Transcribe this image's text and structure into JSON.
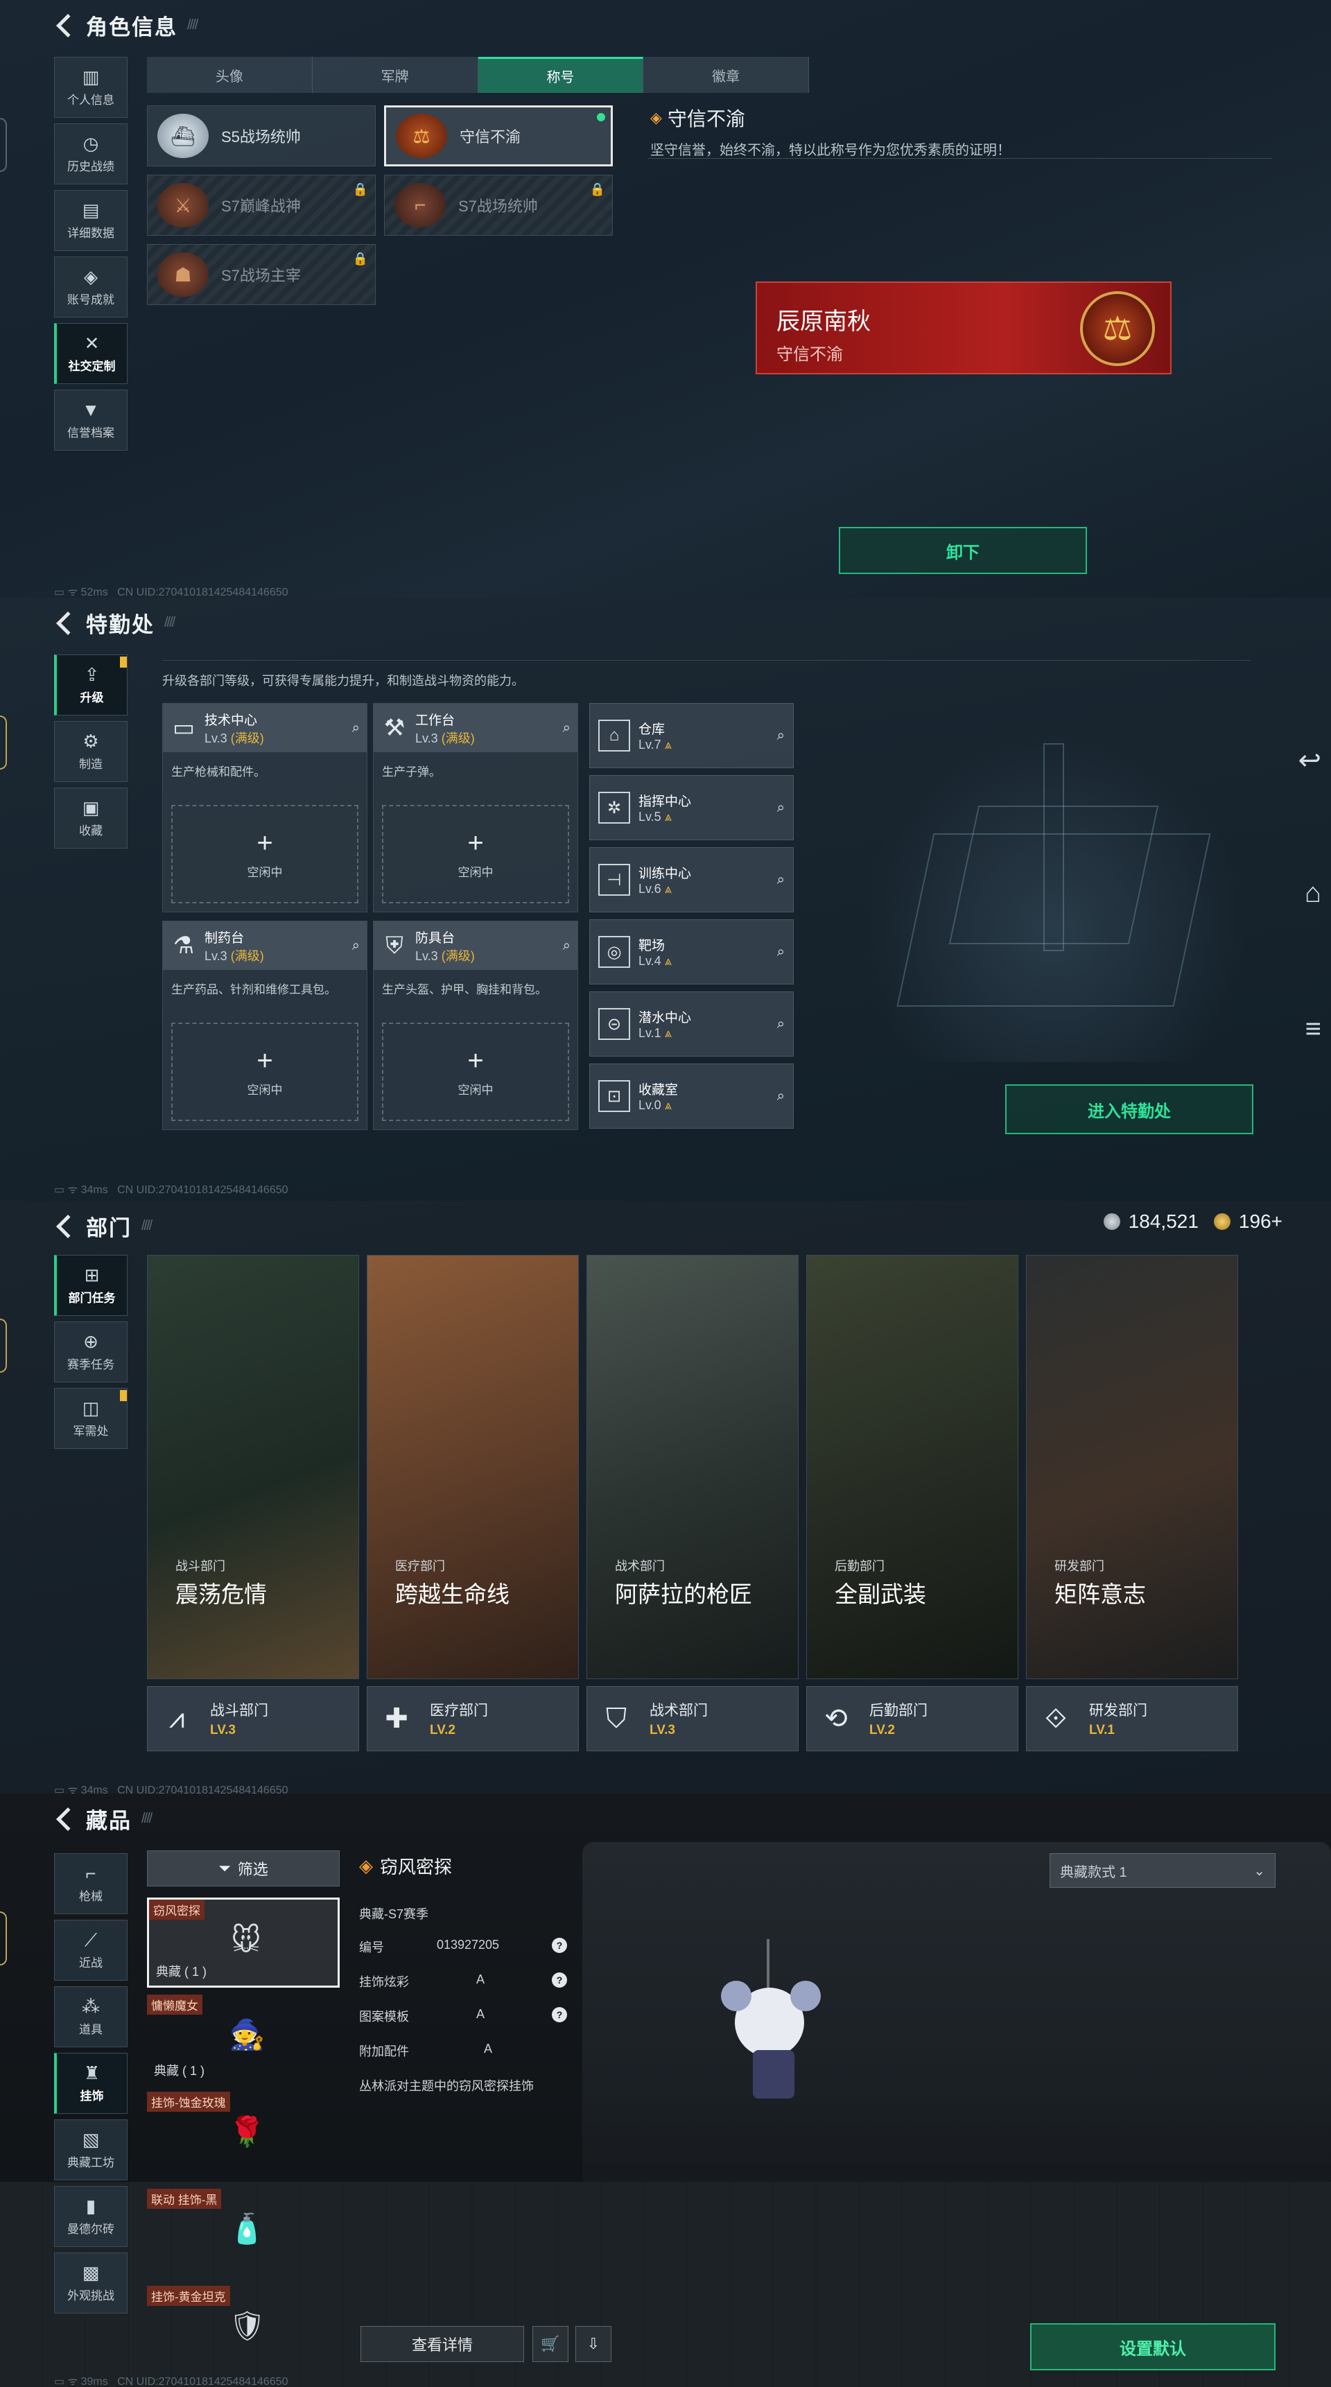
{
  "p1": {
    "title": "角色信息",
    "sidebar": [
      {
        "icon": "▥",
        "label": "个人信息"
      },
      {
        "icon": "◷",
        "label": "历史战绩"
      },
      {
        "icon": "▤",
        "label": "详细数据"
      },
      {
        "icon": "◈",
        "label": "账号成就"
      },
      {
        "icon": "✕",
        "label": "社交定制"
      },
      {
        "icon": "▼",
        "label": "信誉档案"
      }
    ],
    "tabs": [
      "头像",
      "军牌",
      "称号",
      "徽章"
    ],
    "titles": [
      {
        "name": "S5战场统帅",
        "locked": false
      },
      {
        "name": "守信不渝",
        "locked": false
      },
      {
        "name": "S7巅峰战神",
        "locked": true
      },
      {
        "name": "S7战场统帅",
        "locked": true
      },
      {
        "name": "S7战场主宰",
        "locked": true
      }
    ],
    "selected": {
      "name": "守信不渝",
      "desc": "坚守信誉，始终不渝，特以此称号作为您优秀素质的证明！"
    },
    "banner": {
      "player": "辰原南秋",
      "title": "守信不渝"
    },
    "unequip": "卸下",
    "status": "52ms",
    "uid": "CN UID:270410181425484146650"
  },
  "p2": {
    "title": "特勤处",
    "sidebar": [
      {
        "icon": "⇪",
        "label": "升级"
      },
      {
        "icon": "⚙",
        "label": "制造"
      },
      {
        "icon": "▣",
        "label": "收藏"
      }
    ],
    "tip": "升级各部门等级，可获得专属能力提升，和制造战斗物资的能力。",
    "facilities": [
      {
        "icon": "▭",
        "name": "技术中心",
        "lv": "Lv.3",
        "max": "(满级)",
        "desc": "生产枪械和配件。",
        "idle": "空闲中"
      },
      {
        "icon": "⚒",
        "name": "工作台",
        "lv": "Lv.3",
        "max": "(满级)",
        "desc": "生产子弹。",
        "idle": "空闲中"
      },
      {
        "icon": "⚗",
        "name": "制药台",
        "lv": "Lv.3",
        "max": "(满级)",
        "desc": "生产药品、针剂和维修工具包。",
        "idle": "空闲中"
      },
      {
        "icon": "⛨",
        "name": "防具台",
        "lv": "Lv.3",
        "max": "(满级)",
        "desc": "生产头盔、护甲、胸挂和背包。",
        "idle": "空闲中"
      }
    ],
    "rooms": [
      {
        "icon": "⌂",
        "name": "仓库",
        "lv": "Lv.7"
      },
      {
        "icon": "✲",
        "name": "指挥中心",
        "lv": "Lv.5"
      },
      {
        "icon": "⊣",
        "name": "训练中心",
        "lv": "Lv.6"
      },
      {
        "icon": "◎",
        "name": "靶场",
        "lv": "Lv.4"
      },
      {
        "icon": "⊝",
        "name": "潜水中心",
        "lv": "Lv.1"
      },
      {
        "icon": "⊡",
        "name": "收藏室",
        "lv": "Lv.0"
      }
    ],
    "enter": "进入特勤处",
    "status": "34ms",
    "uid": "CN UID:270410181425484146650"
  },
  "p3": {
    "title": "部门",
    "currency": {
      "a": "184,521",
      "b": "196+"
    },
    "sidebar": [
      {
        "icon": "⊞",
        "label": "部门任务"
      },
      {
        "icon": "⊕",
        "label": "赛季任务"
      },
      {
        "icon": "◫",
        "label": "军需处"
      }
    ],
    "cards": [
      {
        "cat": "战斗部门",
        "title": "震荡危情",
        "name": "战斗部门",
        "lv": "LV.3",
        "icon": "⩘",
        "bg": [
          "#2c3d33",
          "#1d2a24",
          "#57452e"
        ]
      },
      {
        "cat": "医疗部门",
        "title": "跨越生命线",
        "name": "医疗部门",
        "lv": "LV.2",
        "icon": "✚",
        "bg": [
          "#8a5a38",
          "#5b3b28",
          "#2e2019"
        ]
      },
      {
        "cat": "战术部门",
        "title": "阿萨拉的枪匠",
        "name": "战术部门",
        "lv": "LV.3",
        "icon": "⛉",
        "bg": [
          "#4a544f",
          "#2a322f",
          "#161c1b"
        ]
      },
      {
        "cat": "后勤部门",
        "title": "全副武装",
        "name": "后勤部门",
        "lv": "LV.2",
        "icon": "⟲",
        "bg": [
          "#3a4232",
          "#252b22",
          "#141815"
        ]
      },
      {
        "cat": "研发部门",
        "title": "矩阵意志",
        "name": "研发部门",
        "lv": "LV.1",
        "icon": "⟐",
        "bg": [
          "#2b2f30",
          "#3f3128",
          "#1b1d1e"
        ]
      }
    ],
    "status": "34ms",
    "uid": "CN UID:270410181425484146650"
  },
  "p4": {
    "title": "藏品",
    "sidebar": [
      {
        "icon": "⌐",
        "label": "枪械"
      },
      {
        "icon": "⟋",
        "label": "近战"
      },
      {
        "icon": "⁂",
        "label": "道具"
      },
      {
        "icon": "♜",
        "label": "挂饰"
      },
      {
        "icon": "▧",
        "label": "典藏工坊"
      },
      {
        "icon": "▮",
        "label": "曼德尔砖"
      },
      {
        "icon": "▩",
        "label": "外观挑战"
      }
    ],
    "filter": "筛选",
    "items": [
      {
        "tag": "窃风密探",
        "count": "典藏 ( 1 )"
      },
      {
        "tag": "慵懒魔女",
        "count": "典藏 ( 1 )"
      },
      {
        "tag": "挂饰-蚀金玫瑰",
        "count": ""
      },
      {
        "tag": "联动 挂饰-黑",
        "count": ""
      },
      {
        "tag": "挂饰-黄金坦克",
        "count": ""
      }
    ],
    "detail": {
      "name": "窃风密探",
      "season": "典藏-S7赛季",
      "rows": [
        {
          "k": "编号",
          "v": "013927205"
        },
        {
          "k": "挂饰炫彩",
          "v": "A"
        },
        {
          "k": "图案模板",
          "v": "A"
        },
        {
          "k": "附加配件",
          "v": "A"
        }
      ],
      "desc": "丛林派对主题中的窃风密探挂饰"
    },
    "dropdown": "典藏款式 1",
    "view": "查看详情",
    "setdef": "设置默认",
    "status": "39ms",
    "uid": "CN UID:270410181425484146650"
  }
}
